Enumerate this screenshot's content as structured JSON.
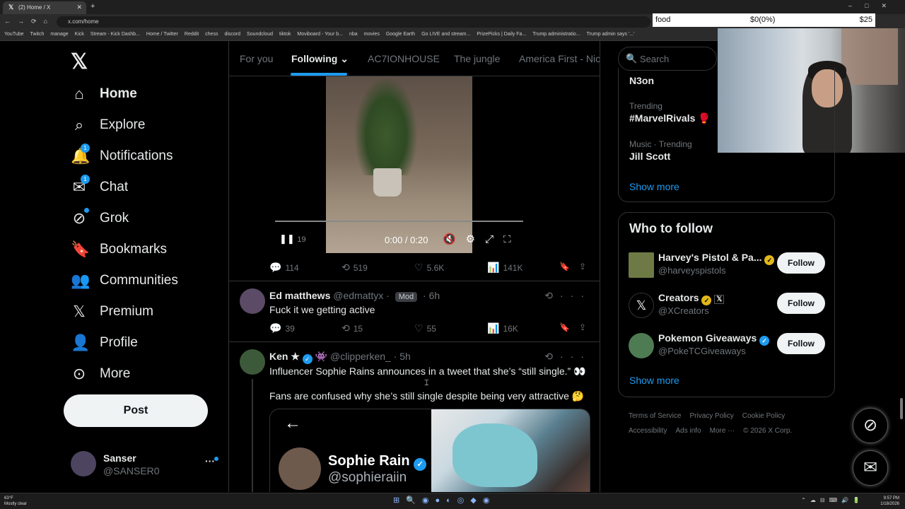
{
  "browser": {
    "tab_title": "(2) Home / X",
    "url": "x.com/home",
    "bookmarks": [
      "YouTube",
      "Twitch",
      "manage",
      "Kick",
      "Stream - Kick Dashb...",
      "Home / Twitter",
      "Reddit",
      "chess",
      "discord",
      "Soundcloud",
      "tiktok",
      "Moviboard - Your b...",
      "nba",
      "movies",
      "Google Earth",
      "Go LIVE and stream...",
      "PrizePicks | Daily Fa...",
      "Trump administratio...",
      "Trump admin says '...'"
    ]
  },
  "overlay": {
    "label": "food",
    "change": "$0(0%)",
    "amount": "$25"
  },
  "sidebar": {
    "items": [
      {
        "label": "Home",
        "icon": "home-icon"
      },
      {
        "label": "Explore",
        "icon": "search-icon"
      },
      {
        "label": "Notifications",
        "icon": "bell-icon",
        "badge": "1"
      },
      {
        "label": "Chat",
        "icon": "mail-icon",
        "badge": "1"
      },
      {
        "label": "Grok",
        "icon": "grok-icon"
      },
      {
        "label": "Bookmarks",
        "icon": "bookmark-icon"
      },
      {
        "label": "Communities",
        "icon": "communities-icon"
      },
      {
        "label": "Premium",
        "icon": "x-icon"
      },
      {
        "label": "Profile",
        "icon": "person-icon"
      },
      {
        "label": "More",
        "icon": "more-circle-icon"
      }
    ],
    "post_label": "Post",
    "account": {
      "name": "Sanser",
      "handle": "@SANSER0"
    }
  },
  "feed": {
    "tabs": [
      "For you",
      "Following",
      "AC7IONHOUSE",
      "The jungle",
      "America First - Nic"
    ],
    "video_tweet": {
      "time": "0:00 / 0:20",
      "ghost_time": "19",
      "stats": {
        "replies": "114",
        "reposts": "519",
        "likes": "5.6K",
        "views": "141K"
      }
    },
    "tweet1": {
      "name": "Ed matthews",
      "handle": "@edmattyx",
      "badge": "Mod",
      "time": "6h",
      "text": "Fuck it we getting active",
      "stats": {
        "replies": "39",
        "reposts": "15",
        "likes": "55",
        "views": "16K"
      }
    },
    "tweet2": {
      "name": "Ken ★",
      "handle": "@clipperken_",
      "time": "5h",
      "text1": "Influencer Sophie Rains announces in a tweet that she’s “still single.” 👀",
      "text2": "Fans are confused why she’s still single despite being very attractive 🤔",
      "embed_name": "Sophie Rain",
      "embed_handle": "@sophieraiin"
    }
  },
  "right": {
    "search_placeholder": "Search",
    "trends": [
      {
        "category": "",
        "name": "N3on"
      },
      {
        "category": "Trending",
        "name": "#MarvelRivals"
      },
      {
        "category": "Music · Trending",
        "name": "Jill Scott"
      }
    ],
    "show_more": "Show more",
    "who_to_follow": {
      "title": "Who to follow",
      "users": [
        {
          "name": "Harvey's Pistol & Pa...",
          "handle": "@harveyspistols"
        },
        {
          "name": "Creators",
          "handle": "@XCreators"
        },
        {
          "name": "Pokemon Giveaways",
          "handle": "@PokeTCGiveaways"
        }
      ],
      "follow_label": "Follow"
    },
    "footer": [
      "Terms of Service",
      "Privacy Policy",
      "Cookie Policy",
      "Accessibility",
      "Ads info",
      "More ···",
      "© 2026 X Corp."
    ]
  },
  "taskbar": {
    "temp": "63°F",
    "weather": "Mostly clear",
    "time": "9:57 PM",
    "date": "1/18/2026"
  },
  "colors": {
    "accent": "#1d9bf0",
    "bg": "#000000",
    "border": "#2f3336",
    "muted": "#71767b"
  }
}
